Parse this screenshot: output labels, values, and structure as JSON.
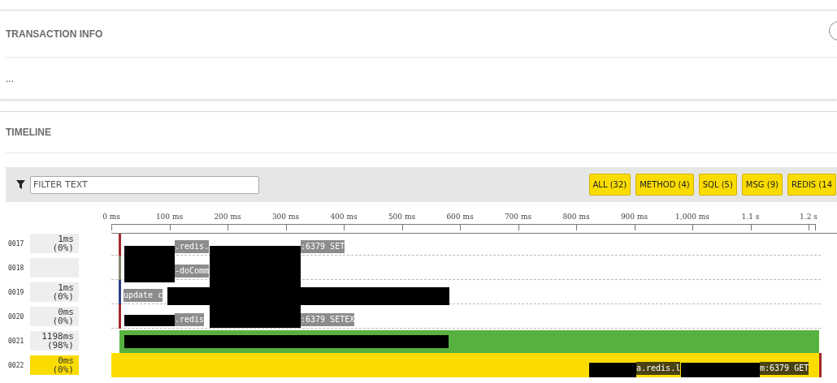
{
  "transaction_info": {
    "title": "TRANSACTION INFO",
    "body": "..."
  },
  "timeline": {
    "title": "TIMELINE",
    "filter": {
      "placeholder": "FILTER TEXT"
    },
    "filter_buttons": [
      {
        "label": "ALL (32)",
        "selected": true
      },
      {
        "label": "METHOD (4)",
        "selected": true
      },
      {
        "label": "SQL (5)",
        "selected": true
      },
      {
        "label": "MSG (9)",
        "selected": true
      },
      {
        "label": "REDIS (14",
        "selected": true
      }
    ],
    "axis_ticks": [
      "0 ms",
      "100 ms",
      "200 ms",
      "300 ms",
      "400 ms",
      "500 ms",
      "600 ms",
      "700 ms",
      "800 ms",
      "900 ms",
      "1,000 ms",
      "1.1 s",
      "1.2 s"
    ],
    "rows": [
      {
        "id": "0017",
        "duration": "1ms",
        "percent": "(0%)",
        "kind": "redis",
        "selected": false,
        "labels": [
          ".redis.",
          ":6379 SET"
        ]
      },
      {
        "id": "0018",
        "kind": "method",
        "selected": false,
        "labels": [
          "-doComm"
        ]
      },
      {
        "id": "0019",
        "duration": "1ms",
        "percent": "(0%)",
        "kind": "sql",
        "selected": false,
        "labels": [
          "update c"
        ]
      },
      {
        "id": "0020",
        "duration": "0ms",
        "percent": "(0%)",
        "kind": "redis",
        "selected": false,
        "labels": [
          ".redis",
          ":6379 SETEX"
        ]
      },
      {
        "id": "0021",
        "duration": "1198ms",
        "percent": "(98%)",
        "kind": "msg",
        "selected": false,
        "labels": []
      },
      {
        "id": "0022",
        "duration": "0ms",
        "percent": "(0%)",
        "kind": "redis",
        "selected": true,
        "labels": [
          "a.redis.l",
          "m:6379 GET"
        ]
      }
    ]
  }
}
